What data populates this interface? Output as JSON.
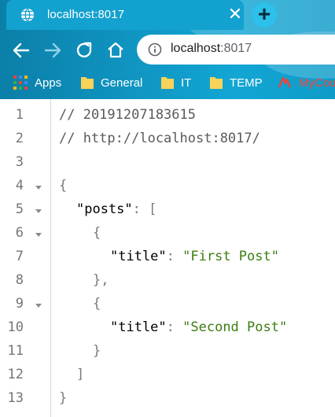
{
  "browser": {
    "tab": {
      "title": "localhost:8017"
    },
    "address": {
      "host": "localhost",
      "port": ":8017"
    },
    "bookmarks": [
      "Apps",
      "General",
      "IT",
      "TEMP",
      "MyCou"
    ]
  },
  "editor": {
    "line_numbers": [
      "1",
      "2",
      "3",
      "4",
      "5",
      "6",
      "7",
      "8",
      "9",
      "10",
      "11",
      "12",
      "13"
    ],
    "lines": {
      "l1": "// 20191207183615",
      "l2": "// http://localhost:8017/",
      "brace_open": "{",
      "posts_key": "\"posts\"",
      "colon": ": ",
      "bracket_open": "[",
      "obj_open": "{",
      "title_key": "\"title\"",
      "title_val_1": "\"First Post\"",
      "obj_close_comma": "},",
      "title_val_2": "\"Second Post\"",
      "obj_close": "}",
      "bracket_close": "]",
      "brace_close": "}"
    }
  }
}
